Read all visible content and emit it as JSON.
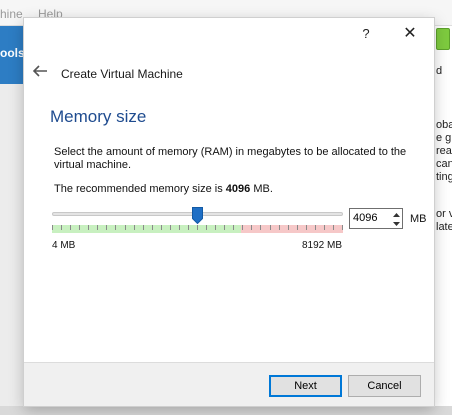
{
  "background": {
    "menu_left": "hine",
    "menu_help": "Help",
    "tools_label": "ools",
    "right_fragments": [
      "d",
      "obal",
      "e gr",
      "reate",
      "can",
      "ting",
      "or v",
      "late"
    ]
  },
  "dialog": {
    "help_glyph": "?",
    "close_glyph": "✕",
    "wizard_title": "Create Virtual Machine",
    "page_title": "Memory size",
    "description": "Select the amount of memory (RAM) in megabytes to be allocated to the virtual machine.",
    "recommended_prefix": "The recommended memory size is ",
    "recommended_value": "4096",
    "recommended_suffix": " MB.",
    "slider": {
      "min_label": "4 MB",
      "max_label": "8192 MB",
      "current_fraction": 0.5
    },
    "spinbox_value": "4096",
    "unit_label": "MB",
    "buttons": {
      "next": "Next",
      "cancel": "Cancel"
    },
    "colors": {
      "title_blue": "#1e4b8f",
      "slider_handle": "#1f6fc5",
      "range_safe": "#c8f0c0",
      "range_danger": "#f6c8c8",
      "default_button_border": "#0078d7"
    }
  }
}
